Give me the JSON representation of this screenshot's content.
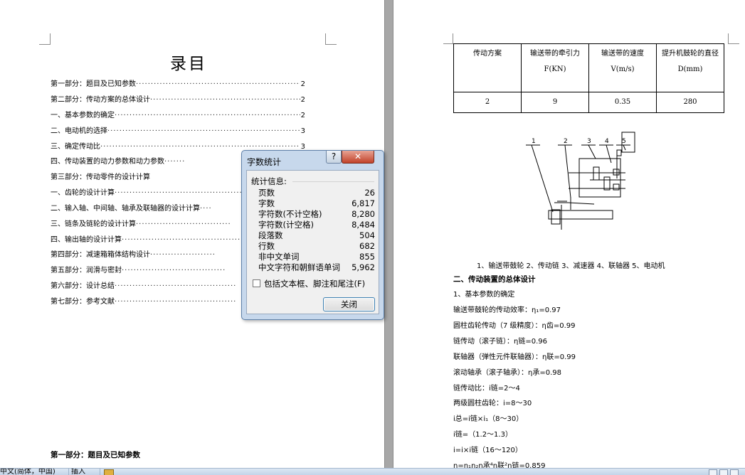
{
  "toc": {
    "title": "录目",
    "entries": [
      {
        "text": "第一部分：题目及已知参数",
        "dots": "·······································································",
        "page": "2"
      },
      {
        "text": "第二部分：传动方案的总体设计",
        "dots": "································································",
        "page": "2"
      },
      {
        "text": "一、基本参数的确定",
        "dots": "·····································································································",
        "page": "2"
      },
      {
        "text": "二、电动机的选择",
        "dots": "·······································································································",
        "page": "3"
      },
      {
        "text": "三、确定传动比",
        "dots": "··········································································································",
        "page": "3"
      },
      {
        "text": "四、传动装置的动力参数和动力参数",
        "dots": "·······",
        "page": ""
      },
      {
        "text": "第三部分：传动零件的设计计算",
        "dots": "",
        "page": ""
      },
      {
        "text": "一、齿轮的设计计算",
        "dots": "··············································",
        "page": ""
      },
      {
        "text": "二、输入轴、中间轴、轴承及联轴器的设计计算",
        "dots": "····",
        "page": ""
      },
      {
        "text": "三、链条及链轮的设计计算",
        "dots": "································",
        "page": ""
      },
      {
        "text": "四、输出轴的设计计算",
        "dots": "············································",
        "page": ""
      },
      {
        "text": "第四部分：减速箱箱体结构设计",
        "dots": "······················",
        "page": ""
      },
      {
        "text": "第五部分：润滑与密封",
        "dots": "···································",
        "page": ""
      },
      {
        "text": "第六部分：设计总结",
        "dots": "·········································",
        "page": ""
      },
      {
        "text": "第七部分：参考文献",
        "dots": "·········································",
        "page": ""
      }
    ],
    "bottom_heading": "第一部分：题目及已知参数"
  },
  "dialog": {
    "title": "字数统计",
    "help_label": "?",
    "close_glyph": "✕",
    "group_label": "统计信息:",
    "stats": [
      {
        "label": "页数",
        "value": "26"
      },
      {
        "label": "字数",
        "value": "6,817"
      },
      {
        "label": "字符数(不计空格)",
        "value": "8,280"
      },
      {
        "label": "字符数(计空格)",
        "value": "8,484"
      },
      {
        "label": "段落数",
        "value": "504"
      },
      {
        "label": "行数",
        "value": "682"
      },
      {
        "label": "非中文单词",
        "value": "855"
      },
      {
        "label": "中文字符和朝鲜语单词",
        "value": "5,962"
      }
    ],
    "checkbox_label": "包括文本框、脚注和尾注(F)",
    "checkbox_checked": false,
    "close_button": "关闭"
  },
  "table": {
    "headers": [
      "传动方案",
      "输送带的牵引力 F(KN)",
      "输送带的速度 V(m/s)",
      "提升机鼓轮的直径 D(mm)"
    ],
    "values": [
      "2",
      "9",
      "0.35",
      "280"
    ]
  },
  "diagram": {
    "labels": [
      "1",
      "2",
      "3",
      "4",
      "5"
    ],
    "caption": "1、输送带鼓轮  2、传动链  3、减速器  4、联轴器  5、电动机"
  },
  "right_text": {
    "section_heading": "二、传动装置的总体设计",
    "sub_heading": "1、基本参数的确定",
    "lines": [
      "输送带鼓轮的传动效率：η₁=0.97",
      "圆柱齿轮传动（7 级精度）：η齿=0.99",
      "链传动（滚子链）：η链=0.96",
      "联轴器（弹性元件联轴器）：η联=0.99",
      "滚动轴承（滚子轴承）：η承=0.98",
      "链传动比：i链=2～4",
      "两级圆柱齿轮：i=8～30",
      "i总=i链×i₁（8～30）",
      "i链=（1.2～1.3）",
      "i=i×i链（16～120）",
      "η=η₁η₂η承⁴η联²η链=0.859"
    ]
  },
  "status_bar": {
    "language": "中文(简体，中国)",
    "mode": "插入"
  }
}
